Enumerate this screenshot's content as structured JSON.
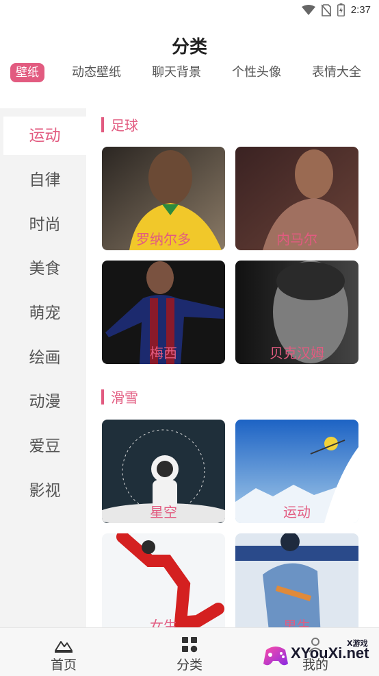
{
  "status_bar": {
    "time": "2:37",
    "icons": [
      "wifi-icon",
      "no-sim-icon",
      "battery-icon"
    ]
  },
  "header": {
    "title": "分类"
  },
  "top_tabs": [
    {
      "label": "壁纸",
      "active": true
    },
    {
      "label": "动态壁纸",
      "active": false
    },
    {
      "label": "聊天背景",
      "active": false
    },
    {
      "label": "个性头像",
      "active": false
    },
    {
      "label": "表情大全",
      "active": false
    }
  ],
  "sidebar": {
    "items": [
      {
        "label": "运动",
        "active": true
      },
      {
        "label": "自律"
      },
      {
        "label": "时尚"
      },
      {
        "label": "美食"
      },
      {
        "label": "萌宠"
      },
      {
        "label": "绘画"
      },
      {
        "label": "动漫"
      },
      {
        "label": "爱豆"
      },
      {
        "label": "影视"
      }
    ]
  },
  "sections": [
    {
      "title": "足球",
      "cards": [
        {
          "label": "罗纳尔多"
        },
        {
          "label": "内马尔"
        },
        {
          "label": "梅西"
        },
        {
          "label": "贝克汉姆"
        }
      ]
    },
    {
      "title": "滑雪",
      "cards": [
        {
          "label": "星空"
        },
        {
          "label": "运动"
        },
        {
          "label": "女生"
        },
        {
          "label": "男生"
        }
      ]
    }
  ],
  "bottom_nav": [
    {
      "label": "首页",
      "icon": "mountain-icon"
    },
    {
      "label": "分类",
      "icon": "grid-icon"
    },
    {
      "label": "我的",
      "icon": "user-icon"
    }
  ],
  "watermark": {
    "text": "XYouXi.net",
    "tag": "X游戏"
  },
  "colors": {
    "accent": "#e25b80",
    "sidebar_bg": "#f3f3f3",
    "nav_bg": "#f7f7f7"
  }
}
